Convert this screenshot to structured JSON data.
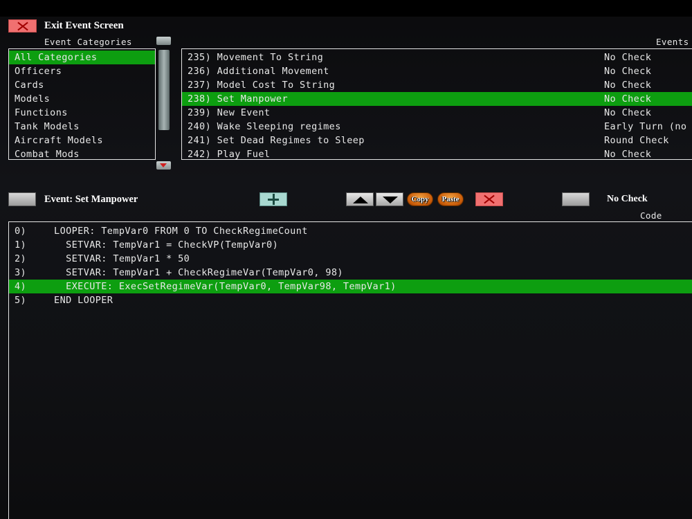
{
  "header": {
    "exit_label": "Exit Event Screen"
  },
  "categories": {
    "title": "Event Categories",
    "items": [
      "All Categories",
      "Officers",
      "Cards",
      "Models",
      "Functions",
      "Tank Models",
      "Aircraft Models",
      "Combat Mods"
    ],
    "selected_index": 0
  },
  "events": {
    "title": "Events",
    "rows": [
      {
        "name": "235) Movement To String",
        "check": "No Check"
      },
      {
        "name": "236) Additional Movement",
        "check": "No Check"
      },
      {
        "name": "237) Model Cost To String",
        "check": "No Check"
      },
      {
        "name": "238) Set Manpower",
        "check": "No Check"
      },
      {
        "name": "239) New Event",
        "check": "No Check"
      },
      {
        "name": "240) Wake Sleeping regimes",
        "check": "Early Turn (no"
      },
      {
        "name": "241) Set Dead Regimes to Sleep",
        "check": "Round Check"
      },
      {
        "name": "242) Play Fuel",
        "check": "No Check"
      }
    ],
    "selected_index": 3
  },
  "toolbar": {
    "event_label": "Event: Set Manpower",
    "copy_label": "Copy",
    "paste_label": "Paste",
    "check_label": "No Check"
  },
  "code": {
    "title": "Code",
    "lines": [
      {
        "num": "0)",
        "text": "  LOOPER: TempVar0 FROM 0 TO CheckRegimeCount"
      },
      {
        "num": "1)",
        "text": "    SETVAR: TempVar1 = CheckVP(TempVar0)"
      },
      {
        "num": "2)",
        "text": "    SETVAR: TempVar1 * 50"
      },
      {
        "num": "3)",
        "text": "    SETVAR: TempVar1 + CheckRegimeVar(TempVar0, 98)"
      },
      {
        "num": "4)",
        "text": "    EXECUTE: ExecSetRegimeVar(TempVar0, TempVar98, TempVar1)"
      },
      {
        "num": "5)",
        "text": "  END LOOPER"
      }
    ],
    "selected_index": 4
  },
  "colors": {
    "selection": "#0d9e10",
    "close": "#f07070",
    "copy_paste": "#d8720f"
  }
}
